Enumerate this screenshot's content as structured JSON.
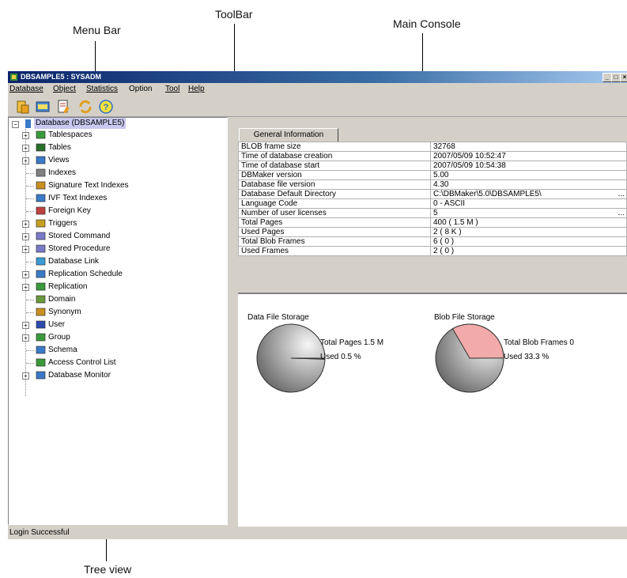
{
  "callouts": {
    "menu_bar": "Menu Bar",
    "toolbar": "ToolBar",
    "main_console": "Main Console",
    "tree_view": "Tree view"
  },
  "window": {
    "title": "DBSAMPLE5 : SYSADM",
    "minimize": "_",
    "maximize": "□",
    "close": "×"
  },
  "menu": [
    "Database",
    "Object",
    "Statistics",
    "Option",
    "Tool",
    "Help"
  ],
  "toolbar_icons": [
    "connect-icon",
    "console-icon",
    "edit-icon",
    "refresh-icon",
    "help-icon"
  ],
  "tree": {
    "root": "Database (DBSAMPLE5)",
    "items": [
      {
        "label": "Tablespaces",
        "icon": "tablespaces-icon",
        "expandable": true
      },
      {
        "label": "Tables",
        "icon": "tables-icon",
        "expandable": true
      },
      {
        "label": "Views",
        "icon": "views-icon",
        "expandable": true
      },
      {
        "label": "Indexes",
        "icon": "indexes-icon",
        "expandable": false
      },
      {
        "label": "Signature Text Indexes",
        "icon": "signature-text-index-icon",
        "expandable": false
      },
      {
        "label": "IVF Text Indexes",
        "icon": "ivf-text-index-icon",
        "expandable": false
      },
      {
        "label": "Foreign Key",
        "icon": "foreign-key-icon",
        "expandable": false
      },
      {
        "label": "Triggers",
        "icon": "triggers-icon",
        "expandable": true
      },
      {
        "label": "Stored Command",
        "icon": "stored-command-icon",
        "expandable": true
      },
      {
        "label": "Stored Procedure",
        "icon": "stored-procedure-icon",
        "expandable": true
      },
      {
        "label": "Database Link",
        "icon": "database-link-icon",
        "expandable": false
      },
      {
        "label": "Replication Schedule",
        "icon": "replication-schedule-icon",
        "expandable": true
      },
      {
        "label": "Replication",
        "icon": "replication-icon",
        "expandable": true
      },
      {
        "label": "Domain",
        "icon": "domain-icon",
        "expandable": false
      },
      {
        "label": "Synonym",
        "icon": "synonym-icon",
        "expandable": false
      },
      {
        "label": "User",
        "icon": "user-icon",
        "expandable": true
      },
      {
        "label": "Group",
        "icon": "group-icon",
        "expandable": true
      },
      {
        "label": "Schema",
        "icon": "schema-icon",
        "expandable": false
      },
      {
        "label": "Access Control List",
        "icon": "access-control-list-icon",
        "expandable": false
      },
      {
        "label": "Database Monitor",
        "icon": "database-monitor-icon",
        "expandable": true
      }
    ]
  },
  "console": {
    "tab_label": "General Information",
    "info_rows": [
      {
        "key": "BLOB frame size",
        "value": "32768"
      },
      {
        "key": "Time of database creation",
        "value": "2007/05/09 10:52:47"
      },
      {
        "key": "Time of database start",
        "value": "2007/05/09 10:54:38"
      },
      {
        "key": "DBMaker version",
        "value": "5.00"
      },
      {
        "key": "Database file version",
        "value": "4.30"
      },
      {
        "key": "Database Default Directory",
        "value": "C:\\DBMaker\\5.0\\DBSAMPLE5\\",
        "more": "..."
      },
      {
        "key": "Language Code",
        "value": "0 - ASCII"
      },
      {
        "key": "Number of user licenses",
        "value": "5",
        "more": "..."
      },
      {
        "key": "Total Pages",
        "value": "400 ( 1.5 M )"
      },
      {
        "key": "Used Pages",
        "value": "2 ( 8 K )"
      },
      {
        "key": "Total Blob Frames",
        "value": "6 ( 0 )"
      },
      {
        "key": "Used Frames",
        "value": "2 ( 0 )"
      }
    ],
    "charts": {
      "data_file": {
        "title": "Data File Storage",
        "total_label": "Total Pages 1.5 M",
        "used_label": "Used 0.5 %",
        "used_fraction": 0.005
      },
      "blob_file": {
        "title": "Blob File Storage",
        "total_label": "Total Blob Frames 0",
        "used_label": "Used 33.3 %",
        "used_fraction": 0.333
      }
    }
  },
  "status": "Login Successful",
  "colors": {
    "window_bg": "#d4d0c8",
    "tree_selected": "#c8c8f0",
    "used_slice": "#f2aaaa",
    "pie_dark": "#6a6a6a",
    "pie_light": "#f2f2f2"
  }
}
